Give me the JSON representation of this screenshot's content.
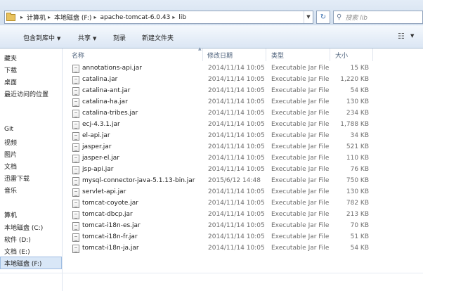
{
  "address": {
    "breadcrumbs": [
      "计算机",
      "本地磁盘 (F:)",
      "apache-tomcat-6.0.43",
      "lib"
    ],
    "search_placeholder": "搜索 lib"
  },
  "toolbar": {
    "include_in_library": "包含到库中",
    "share": "共享",
    "burn": "刻录",
    "new_folder": "新建文件夹"
  },
  "nav": {
    "items": [
      "藏夹",
      "下载",
      "桌面",
      "最近访问的位置",
      "Git",
      "视频",
      "图片",
      "文档",
      "迅雷下载",
      "音乐",
      "算机",
      "本地磁盘 (C:)",
      "软件 (D:)",
      "文档 (E:)",
      "本地磁盘 (F:)"
    ],
    "selected": "本地磁盘 (F:)"
  },
  "columns": {
    "name": "名称",
    "date": "修改日期",
    "type": "类型",
    "size": "大小"
  },
  "files": [
    {
      "name": "annotations-api.jar",
      "date": "2014/11/14 10:05",
      "type": "Executable Jar File",
      "size": "15 KB"
    },
    {
      "name": "catalina.jar",
      "date": "2014/11/14 10:05",
      "type": "Executable Jar File",
      "size": "1,220 KB"
    },
    {
      "name": "catalina-ant.jar",
      "date": "2014/11/14 10:05",
      "type": "Executable Jar File",
      "size": "54 KB"
    },
    {
      "name": "catalina-ha.jar",
      "date": "2014/11/14 10:05",
      "type": "Executable Jar File",
      "size": "130 KB"
    },
    {
      "name": "catalina-tribes.jar",
      "date": "2014/11/14 10:05",
      "type": "Executable Jar File",
      "size": "234 KB"
    },
    {
      "name": "ecj-4.3.1.jar",
      "date": "2014/11/14 10:05",
      "type": "Executable Jar File",
      "size": "1,788 KB"
    },
    {
      "name": "el-api.jar",
      "date": "2014/11/14 10:05",
      "type": "Executable Jar File",
      "size": "34 KB"
    },
    {
      "name": "jasper.jar",
      "date": "2014/11/14 10:05",
      "type": "Executable Jar File",
      "size": "521 KB"
    },
    {
      "name": "jasper-el.jar",
      "date": "2014/11/14 10:05",
      "type": "Executable Jar File",
      "size": "110 KB"
    },
    {
      "name": "jsp-api.jar",
      "date": "2014/11/14 10:05",
      "type": "Executable Jar File",
      "size": "76 KB"
    },
    {
      "name": "mysql-connector-java-5.1.13-bin.jar",
      "date": "2015/6/12 14:48",
      "type": "Executable Jar File",
      "size": "750 KB"
    },
    {
      "name": "servlet-api.jar",
      "date": "2014/11/14 10:05",
      "type": "Executable Jar File",
      "size": "130 KB"
    },
    {
      "name": "tomcat-coyote.jar",
      "date": "2014/11/14 10:05",
      "type": "Executable Jar File",
      "size": "782 KB"
    },
    {
      "name": "tomcat-dbcp.jar",
      "date": "2014/11/14 10:05",
      "type": "Executable Jar File",
      "size": "213 KB"
    },
    {
      "name": "tomcat-i18n-es.jar",
      "date": "2014/11/14 10:05",
      "type": "Executable Jar File",
      "size": "70 KB"
    },
    {
      "name": "tomcat-i18n-fr.jar",
      "date": "2014/11/14 10:05",
      "type": "Executable Jar File",
      "size": "51 KB"
    },
    {
      "name": "tomcat-i18n-ja.jar",
      "date": "2014/11/14 10:05",
      "type": "Executable Jar File",
      "size": "54 KB"
    }
  ]
}
